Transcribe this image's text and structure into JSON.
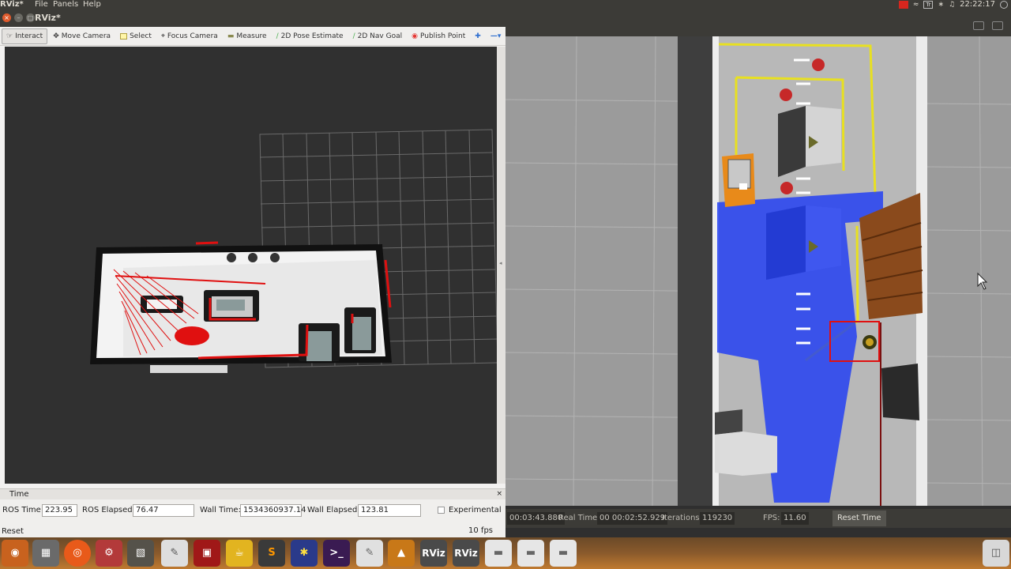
{
  "menubar": {
    "app": "RViz*",
    "menus": [
      "File",
      "Panels",
      "Help"
    ],
    "tray_lang": "Tr",
    "clock": "22:22:17"
  },
  "rviz": {
    "title": "RViz*",
    "toolbar": {
      "interact": "Interact",
      "move_camera": "Move Camera",
      "select": "Select",
      "focus_camera": "Focus Camera",
      "measure": "Measure",
      "pose_estimate": "2D Pose Estimate",
      "nav_goal": "2D Nav Goal",
      "publish_point": "Publish Point"
    },
    "time_panel": {
      "title": "Time",
      "ros_time_label": "ROS Time:",
      "ros_time": "223.95",
      "ros_elapsed_label": "ROS Elapsed:",
      "ros_elapsed": "76.47",
      "wall_time_label": "Wall Time:",
      "wall_time": "1534360937.14",
      "wall_elapsed_label": "Wall Elapsed:",
      "wall_elapsed": "123.81",
      "experimental_label": "Experimental",
      "reset_label": "Reset",
      "fps": "10 fps"
    }
  },
  "gazebo": {
    "sim_time": "00:03:43.880",
    "real_time_label": "Real Time:",
    "real_time": "00 00:02:52.929",
    "iterations_label": "Iterations:",
    "iterations": "119230",
    "fps_label": "FPS:",
    "fps": "11.60",
    "reset_time_label": "Reset Time"
  },
  "launcher": {
    "rviz_label_1": "RViz",
    "rviz_label_2": "RViz"
  },
  "colors": {
    "laser_red": "#e01010",
    "laser_blue": "#1f3cf5",
    "line_yellow": "#e8e020",
    "robot_orange": "#e88a1a"
  }
}
